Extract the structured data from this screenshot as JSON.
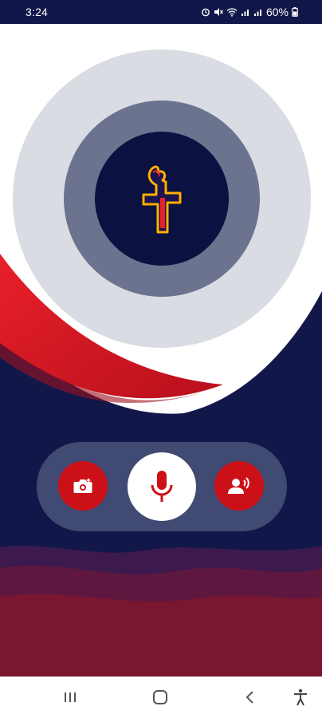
{
  "status_bar": {
    "time": "3:24",
    "battery": "60%",
    "icons": [
      "alarm-icon",
      "mute-icon",
      "wifi-icon",
      "signal-icon",
      "signal-icon",
      "battery-icon"
    ]
  },
  "app": {
    "logo": "cross-with-flame-icon",
    "colors": {
      "navy": "#111849",
      "red": "#d81b23",
      "dark_red": "#7a1630",
      "gray_ring": "#dadce3",
      "slate_ring": "#6b738e",
      "control_bar": "#414a72"
    }
  },
  "controls": {
    "camera_icon": "camera-icon",
    "mic_icon": "microphone-icon",
    "voice_icon": "voice-user-icon"
  },
  "nav_bar": {
    "icons": [
      "recents-icon",
      "home-icon",
      "back-icon",
      "accessibility-icon"
    ]
  }
}
